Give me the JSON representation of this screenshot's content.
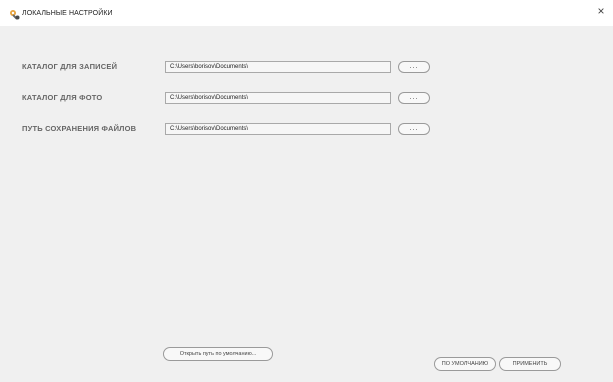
{
  "window": {
    "title": "ЛОКАЛЬНЫЕ НАСТРОЙКИ",
    "close_glyph": "×"
  },
  "rows": [
    {
      "label": "КАТАЛОГ ДЛЯ ЗАПИСЕЙ",
      "path": "C:\\Users\\borisov\\Documents\\",
      "browse_label": "..."
    },
    {
      "label": "КАТАЛОГ ДЛЯ ФОТО",
      "path": "C:\\Users\\borisov\\Documents\\",
      "browse_label": "..."
    },
    {
      "label": "ПУТЬ СОХРАНЕНИЯ ФАЙЛОВ",
      "path": "C:\\Users\\borisov\\Documents\\",
      "browse_label": "..."
    }
  ],
  "buttons": {
    "open_default": "Открыть путь по умолчанию...",
    "defaults": "ПО УМОЛЧАНИЮ",
    "apply": "ПРИМЕНИТЬ"
  },
  "icons": {
    "title_icon": "settings-wrench-icon",
    "close": "close-icon"
  }
}
